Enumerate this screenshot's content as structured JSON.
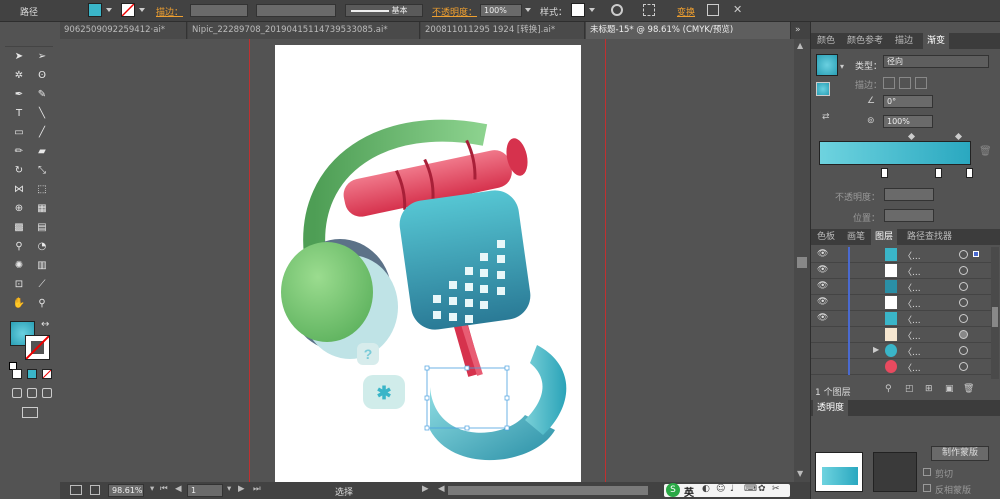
{
  "control_bar": {
    "path_label": "路径",
    "stroke_label": "描边：",
    "stroke_style": "基本",
    "opacity_label": "不透明度：",
    "opacity_value": "100%",
    "style_label": "样式：",
    "transform_label": "变换"
  },
  "tabs": [
    {
      "label": "9062509092259412·ai*",
      "active": false
    },
    {
      "label": "Nipic_22289708_20190415114739533085.ai*",
      "active": false
    },
    {
      "label": "200811011295 1924 [转换].ai*",
      "active": false
    },
    {
      "label": "未标题-15* @ 98.61% (CMYK/预览)",
      "active": true
    }
  ],
  "statusbar": {
    "zoom": "98.61%",
    "page": "1",
    "tool": "选择"
  },
  "gradient_panel": {
    "tabs": [
      "颜色",
      "颜色参考",
      "描边",
      "渐变"
    ],
    "active_tab": "渐变",
    "type_label": "类型：",
    "type_value": "径向",
    "stroke_label": "描边：",
    "angle_value": "0°",
    "aspect_value": "100%",
    "opacity_label": "不透明度：",
    "position_label": "位置："
  },
  "layers_panel": {
    "tabs": [
      "色板",
      "画笔",
      "图层",
      "路径查找器"
    ],
    "active_tab": "图层",
    "count_label": "1 个图层",
    "rows": [
      "〈...",
      "〈...",
      "〈...",
      "〈...",
      "〈...",
      "〈...",
      "〈...",
      "〈..."
    ]
  },
  "transparency_panel": {
    "title": "透明度",
    "make_mask": "制作蒙版",
    "clip": "剪切",
    "invert_mask": "反相蒙版"
  },
  "ime": {
    "label": "英"
  },
  "colors": {
    "teal": "#3ab5c8",
    "green": "#5cb85c",
    "red": "#e84a5f",
    "orange_label": "#f0a030"
  }
}
